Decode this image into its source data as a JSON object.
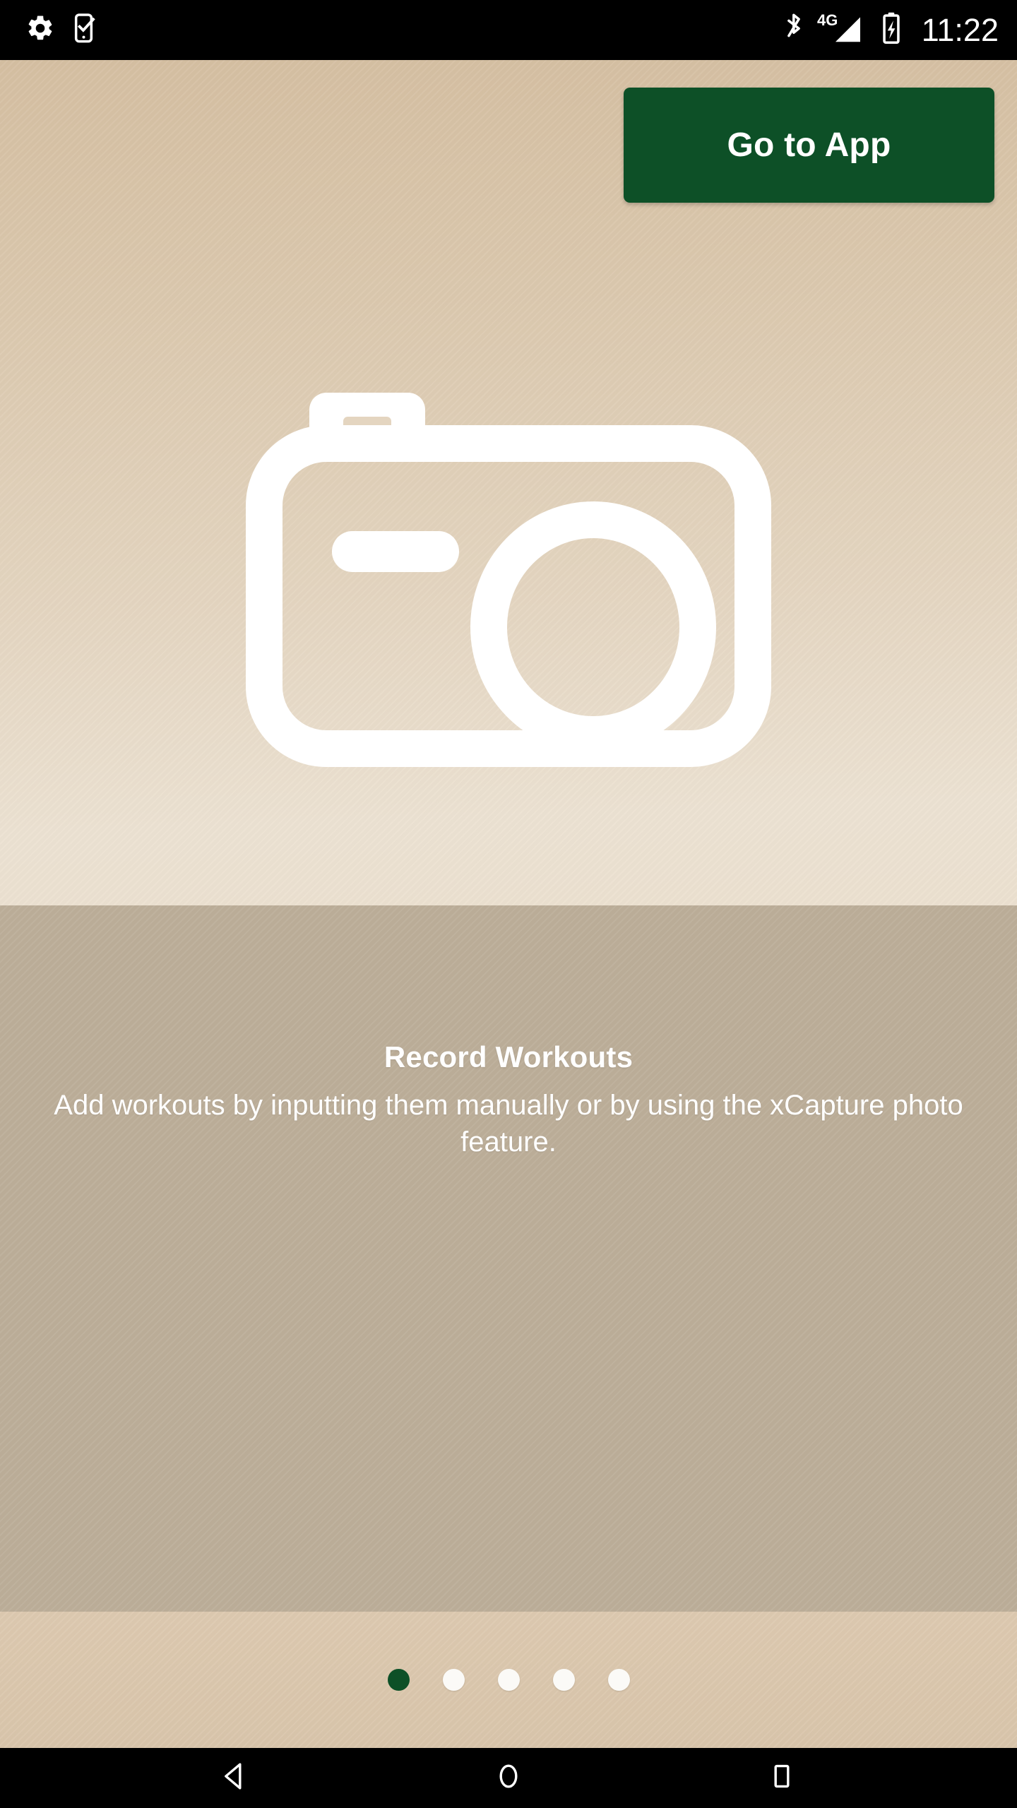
{
  "status_bar": {
    "left_icons": [
      {
        "name": "settings-gear-icon",
        "label": "Settings"
      },
      {
        "name": "phone-checklist-icon",
        "label": "Phone task"
      }
    ],
    "right_icons": [
      {
        "name": "bluetooth-icon",
        "label": "Bluetooth"
      },
      {
        "name": "signal-4g-icon",
        "label": "4G"
      },
      {
        "name": "battery-charging-icon",
        "label": "Charging"
      }
    ],
    "network_label": "4G",
    "time": "11:22"
  },
  "header": {
    "go_to_app_label": "Go to App"
  },
  "hero": {
    "icon": "camera-icon",
    "icon_color": "#ffffff",
    "background_top": "#d5bfa2",
    "background_bottom": "#ece1d0"
  },
  "onboarding": {
    "title": "Record Workouts",
    "description": "Add workouts by inputting them manually or by using the xCapture photo feature.",
    "panel_background": "#bcae99",
    "text_color": "#ffffff"
  },
  "pager": {
    "total": 5,
    "active_index": 0,
    "active_color": "#0d5027",
    "inactive_color": "#fbfaf7",
    "dots": [
      {
        "state": "active"
      },
      {
        "state": "inactive"
      },
      {
        "state": "inactive"
      },
      {
        "state": "inactive"
      },
      {
        "state": "inactive"
      }
    ]
  },
  "nav_bar": {
    "buttons": [
      {
        "name": "back-button",
        "label": "Back"
      },
      {
        "name": "home-button",
        "label": "Home"
      },
      {
        "name": "recents-button",
        "label": "Recents"
      }
    ]
  },
  "colors": {
    "accent_green": "#0d5027",
    "status_bar": "#000000",
    "nav_bar": "#000000"
  }
}
